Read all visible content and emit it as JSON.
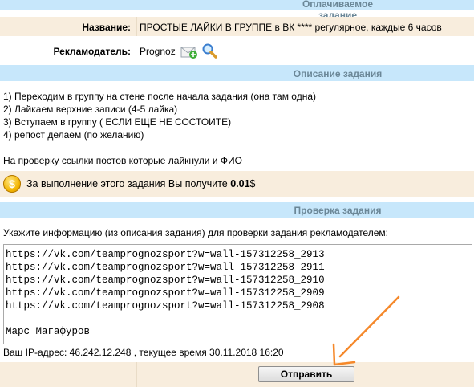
{
  "paid_task": {
    "header": "Оплачиваемое задание",
    "name_label": "Название:",
    "name_value": "ПРОСТЫЕ ЛАЙКИ В ГРУППЕ в ВК **** регулярное, каждые 6 часов",
    "advertiser_label": "Рекламодатель:",
    "advertiser_name": "Prognoz",
    "advertiser_icons": [
      "envelope-plus-icon",
      "magnifier-icon"
    ]
  },
  "description": {
    "header": "Описание задания",
    "lines": [
      "1) Переходим в группу на стене после начала задания (она там одна)",
      "2) Лайкаем верхние записи (4-5 лайка)",
      "3) Вступаем в группу ( ЕСЛИ ЕЩЕ НЕ СОСТОИТЕ)",
      "4) репост делаем (по желанию)",
      "",
      "На проверку ссылки постов которые лайкнули и ФИО"
    ],
    "reward_text": "За выполнение этого задания Вы получите ",
    "reward_amount": "0.01",
    "reward_currency": "$",
    "coin_symbol": "$"
  },
  "check": {
    "header": "Проверка задания",
    "instruction": "Укажите информацию (из описания задания) для проверки задания рекламодателем:",
    "textarea_value": "https://vk.com/teamprognozsport?w=wall-157312258_2913\nhttps://vk.com/teamprognozsport?w=wall-157312258_2911\nhttps://vk.com/teamprognozsport?w=wall-157312258_2910\nhttps://vk.com/teamprognozsport?w=wall-157312258_2909\nhttps://vk.com/teamprognozsport?w=wall-157312258_2908\n\nМарс Магафуров",
    "ip_info": "Ваш IP-адрес: 46.242.12.248 , текущее время 30.11.2018 16:20",
    "submit_label": "Отправить"
  },
  "colors": {
    "header_bg": "#c7e7fb",
    "header_text": "#6b8797",
    "row_bg": "#f8eddd",
    "annotation_arrow": "#f5882a"
  }
}
